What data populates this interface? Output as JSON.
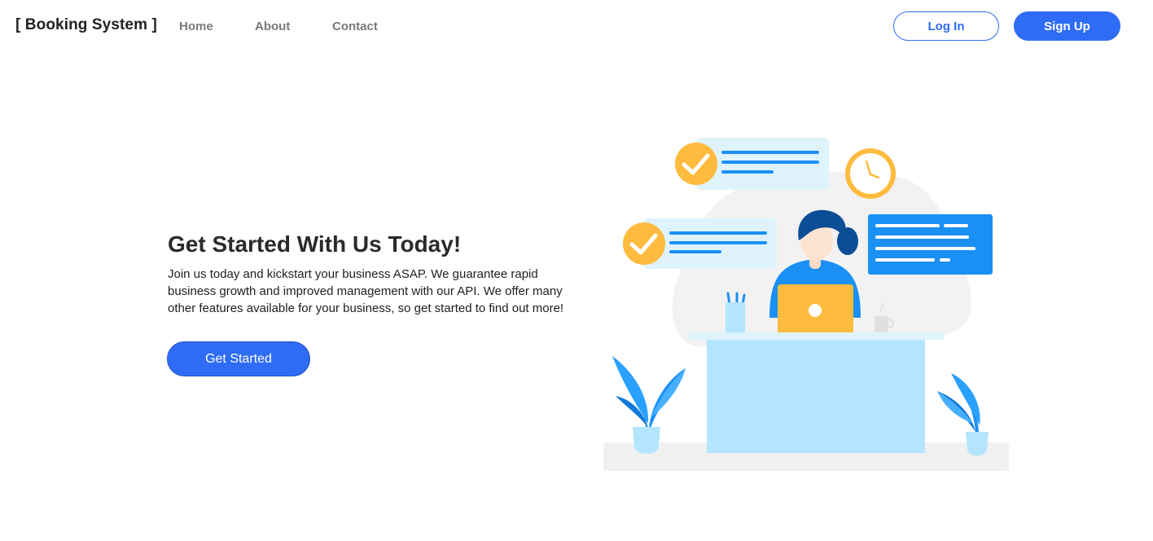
{
  "navbar": {
    "brand": "[ Booking System ]",
    "links": [
      {
        "label": "Home"
      },
      {
        "label": "About"
      },
      {
        "label": "Contact"
      }
    ],
    "login_label": "Log In",
    "signup_label": "Sign Up"
  },
  "hero": {
    "title": "Get Started With Us Today!",
    "description": "Join us today and kickstart your business ASAP. We guarantee rapid business growth and improved management with our API. We offer many other features available for your business, so get started to find out more!",
    "cta_label": "Get Started"
  },
  "colors": {
    "primary": "#2f6cf6",
    "accent_yellow": "#ffbb3d",
    "accent_blue": "#1a90f5",
    "light_blue": "#b3e6fd"
  },
  "illustration": {
    "name": "person-working-at-laptop-illustration"
  }
}
